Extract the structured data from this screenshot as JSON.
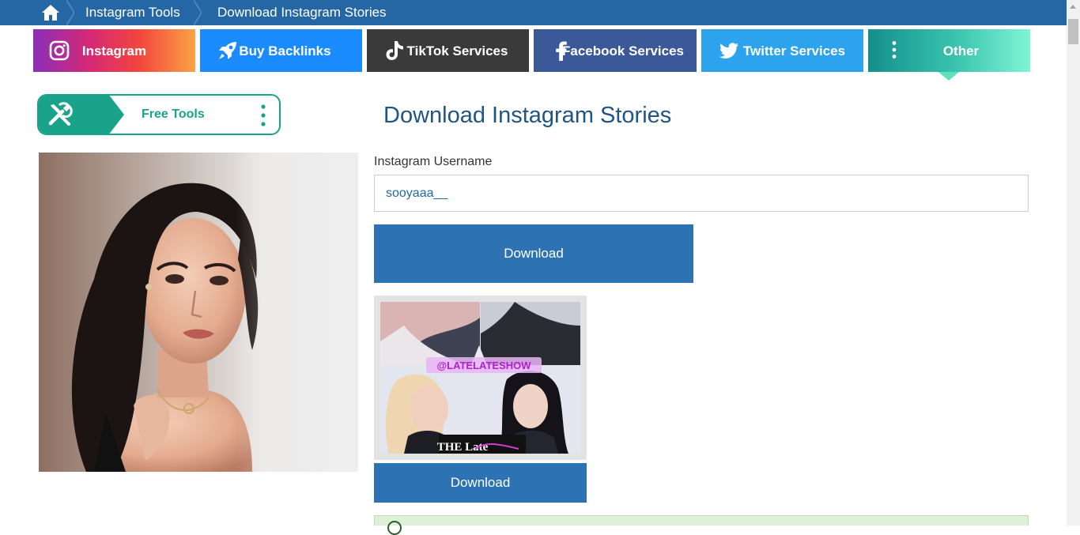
{
  "breadcrumb": {
    "home_icon": "home-icon",
    "items": [
      "Instagram Tools",
      "Download Instagram Stories"
    ]
  },
  "nav": {
    "items": [
      {
        "label": "Instagram",
        "icon": "instagram-icon"
      },
      {
        "label": "Buy Backlinks",
        "icon": "rocket-icon"
      },
      {
        "label": "TikTok Services",
        "icon": "tiktok-icon"
      },
      {
        "label": "Facebook Services",
        "icon": "facebook-icon"
      },
      {
        "label": "Twitter Services",
        "icon": "twitter-icon"
      },
      {
        "label": "Other",
        "icon": "vertical-dots-icon"
      }
    ]
  },
  "sidebar": {
    "free_tools_label": "Free Tools",
    "free_tools_icon": "tools-icon"
  },
  "main": {
    "title": "Download Instagram Stories",
    "username_label": "Instagram Username",
    "username_value": "sooyaaa__",
    "download_label": "Download",
    "story": {
      "overlay_tag": "@LATELATESHOW",
      "overlay_caption": "THE Late",
      "download_label": "Download"
    }
  },
  "colors": {
    "breadcrumb_bg": "#2567a5",
    "primary_button": "#2d73b3",
    "title": "#1f5484",
    "free_tools_accent": "#19a38a",
    "alert_bg": "#dff0d8"
  }
}
